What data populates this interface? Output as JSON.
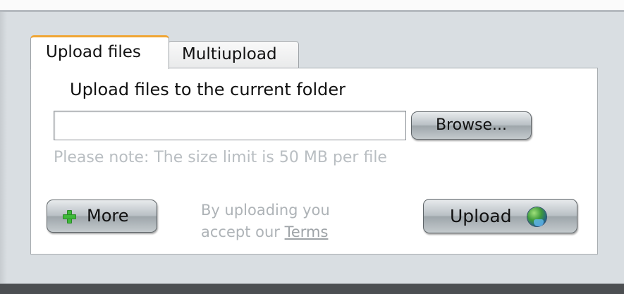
{
  "tabs": [
    {
      "label": "Upload files",
      "active": true
    },
    {
      "label": "Multiupload",
      "active": false
    }
  ],
  "panel": {
    "heading": "Upload files to the current folder",
    "file_input": {
      "value": "",
      "placeholder": ""
    },
    "browse_label": "Browse...",
    "note": "Please note: The size limit is 50 MB per file",
    "more_label": "More",
    "terms_line1": "By uploading you",
    "terms_line2_prefix": "accept our ",
    "terms_link": "Terms",
    "upload_label": "Upload"
  },
  "icons": {
    "more": "plus-icon",
    "upload": "globe-icon"
  },
  "colors": {
    "active_tab_accent": "#f0a533",
    "note_text": "#b9bec2",
    "plus_green": "#3fb93a"
  }
}
